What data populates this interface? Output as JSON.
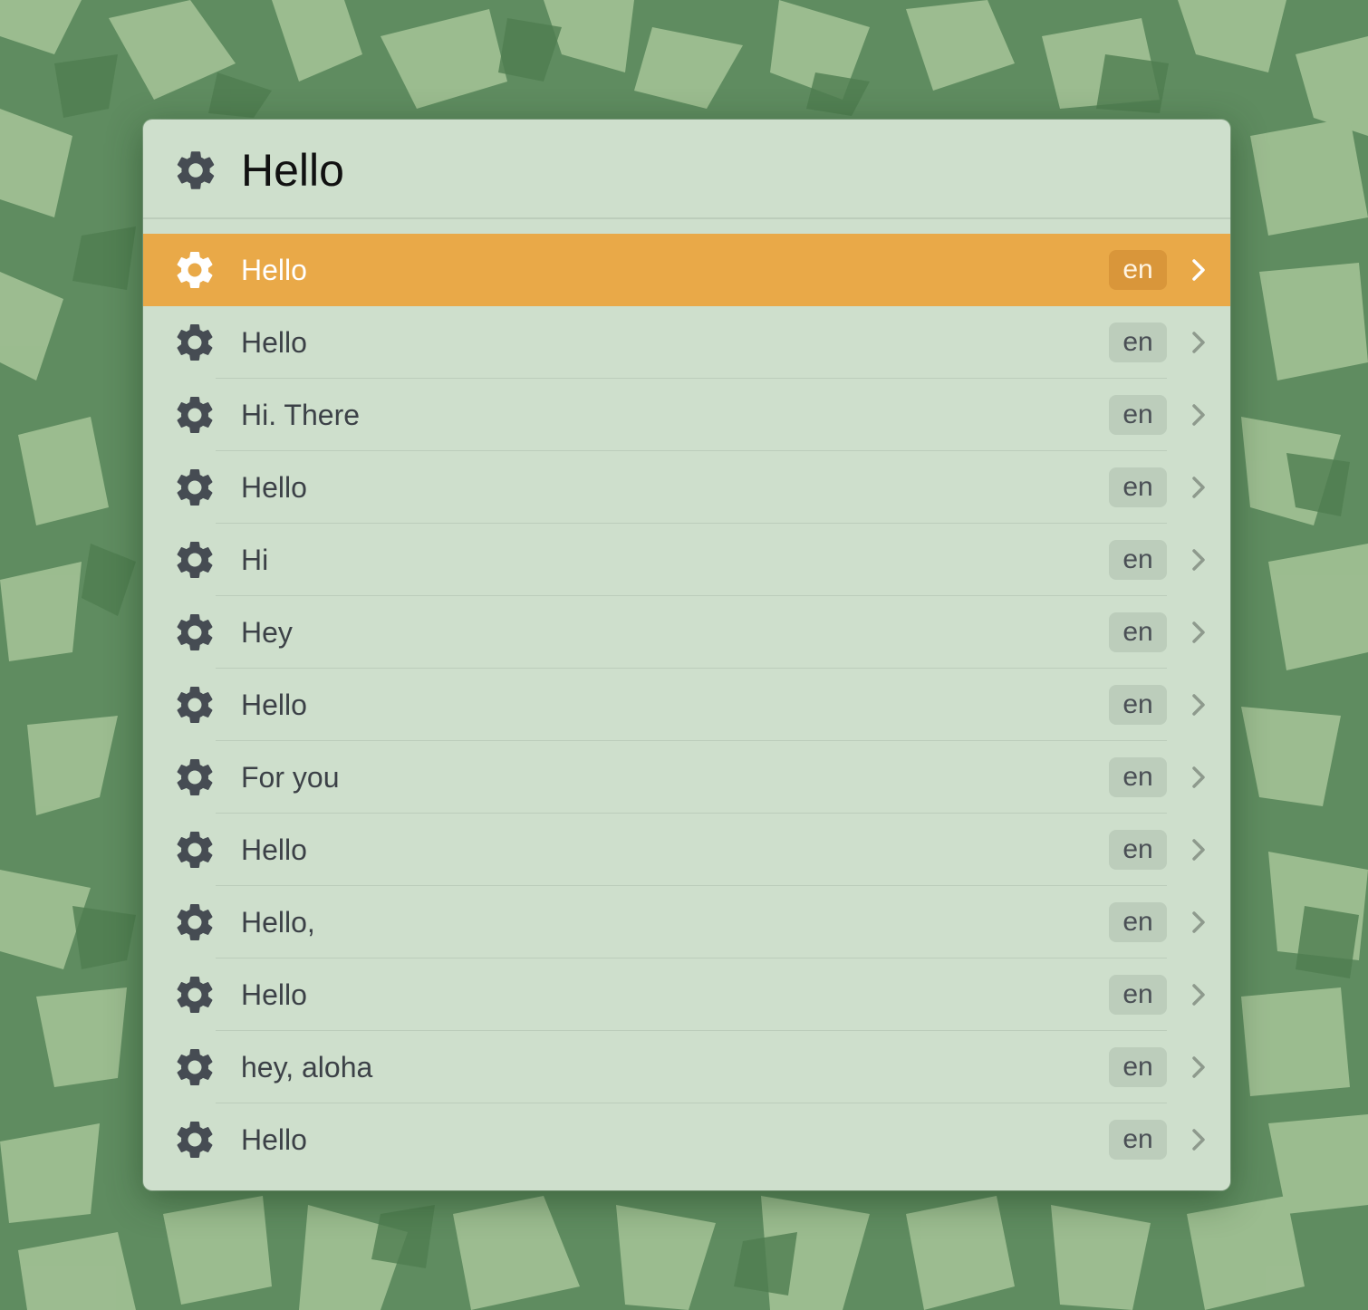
{
  "search": {
    "query": "Hello",
    "icon": "gear-icon"
  },
  "results": [
    {
      "label": "Hello",
      "lang": "en",
      "selected": true
    },
    {
      "label": "Hello",
      "lang": "en"
    },
    {
      "label": "Hi. There",
      "lang": "en"
    },
    {
      "label": "Hello",
      "lang": "en"
    },
    {
      "label": "Hi",
      "lang": "en"
    },
    {
      "label": "Hey",
      "lang": "en"
    },
    {
      "label": "Hello",
      "lang": "en"
    },
    {
      "label": "For you",
      "lang": "en"
    },
    {
      "label": "Hello",
      "lang": "en"
    },
    {
      "label": "Hello,",
      "lang": "en"
    },
    {
      "label": "Hello",
      "lang": "en"
    },
    {
      "label": "hey, aloha",
      "lang": "en"
    },
    {
      "label": "Hello",
      "lang": "en"
    }
  ],
  "colors": {
    "accent": "#e9a948",
    "panel": "#cedfcc",
    "icon": "#464c53",
    "wallpaper_dark": "#5f8c60",
    "wallpaper_light": "#a3c296"
  }
}
